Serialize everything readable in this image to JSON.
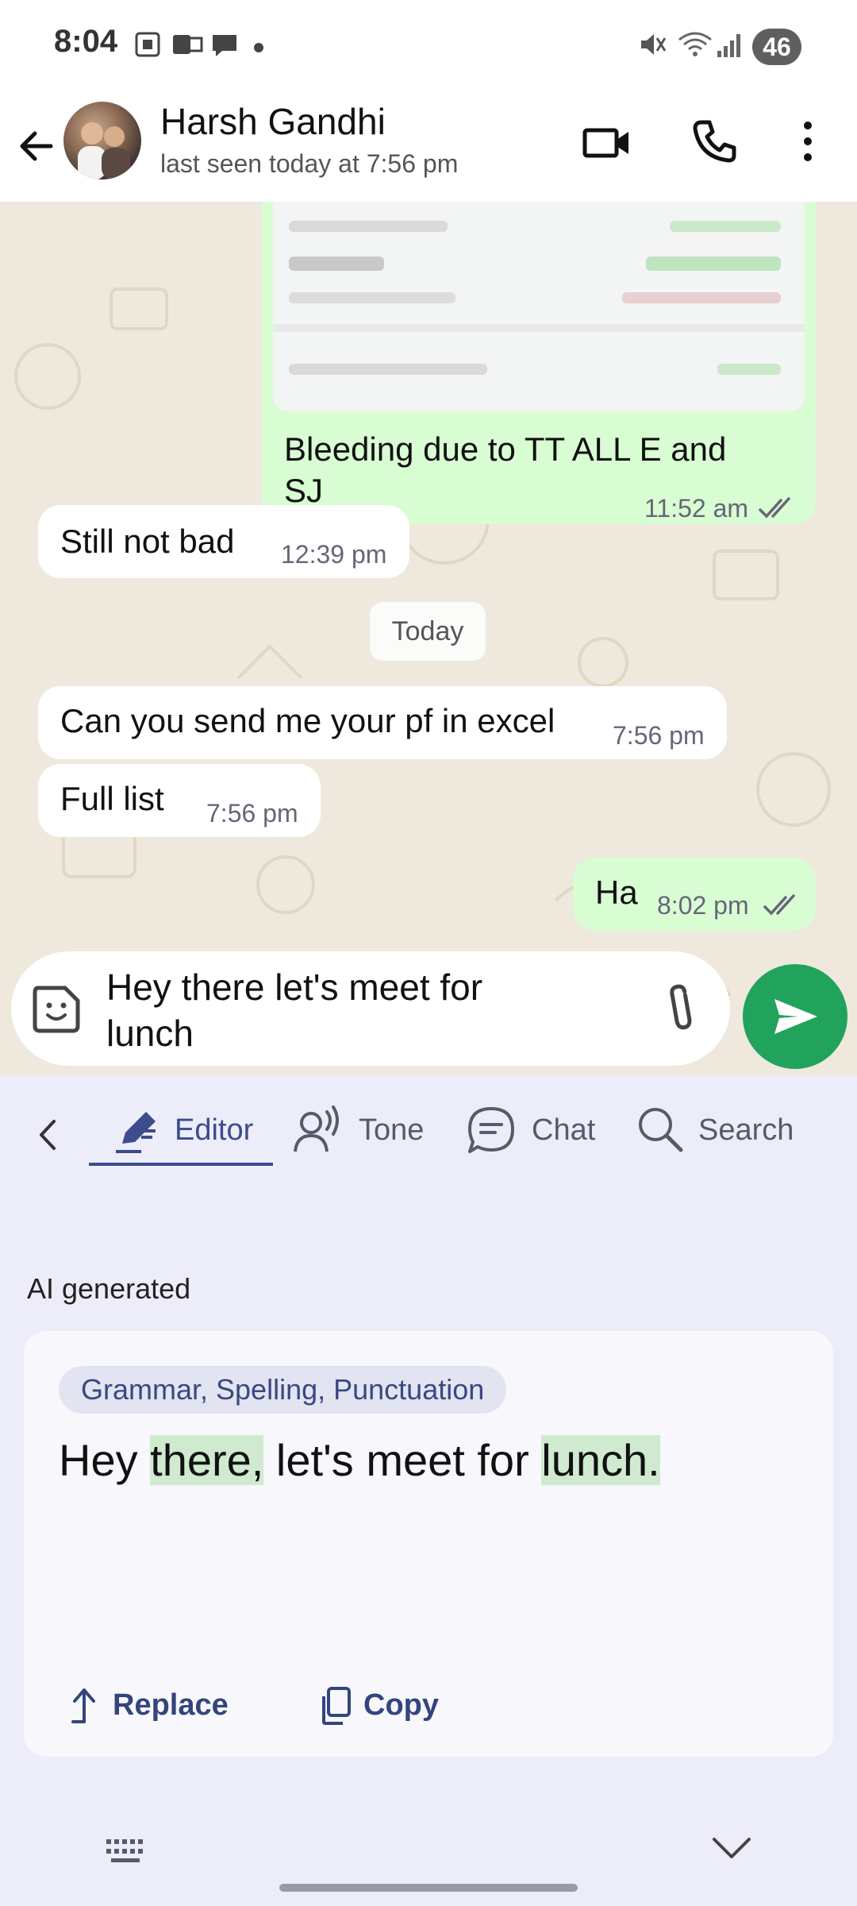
{
  "status_bar": {
    "time": "8:04",
    "battery": "46"
  },
  "header": {
    "contact_name": "Harsh Gandhi",
    "last_seen": "last seen today at 7:56 pm"
  },
  "messages": [
    {
      "direction": "out",
      "text_line1": "Bleeding due to TT ALL E and",
      "text_line2": "SJ",
      "time": "11:52 am",
      "status": "read"
    },
    {
      "direction": "in",
      "text": "Still not bad",
      "time": "12:39 pm"
    },
    {
      "direction": "in",
      "text": "Can you send me your pf in excel",
      "time": "7:56 pm"
    },
    {
      "direction": "in",
      "text": "Full list",
      "time": "7:56 pm"
    },
    {
      "direction": "out",
      "text": "Ha",
      "time": "8:02 pm",
      "status": "read"
    }
  ],
  "date_separator": "Today",
  "composer": {
    "text_line1": "Hey there let's meet for",
    "text_line2": "lunch"
  },
  "ai_panel": {
    "tabs": [
      {
        "label": "Editor",
        "icon": "pen-icon",
        "active": true
      },
      {
        "label": "Tone",
        "icon": "voice-icon",
        "active": false
      },
      {
        "label": "Chat",
        "icon": "chat-bubble-icon",
        "active": false
      },
      {
        "label": "Search",
        "icon": "search-icon",
        "active": false
      }
    ],
    "section_label": "AI generated",
    "suggestion": {
      "category": "Grammar, Spelling, Punctuation",
      "parts": [
        "Hey ",
        "there,",
        " let's meet for ",
        "lunch."
      ]
    },
    "actions": {
      "replace": "Replace",
      "copy": "Copy"
    }
  },
  "colors": {
    "accent": "#21a35b",
    "outgoing_bubble": "#d9fdd3",
    "panel_bg": "#ecedf8",
    "highlight": "#cfeacf",
    "link_blue": "#34457d"
  }
}
